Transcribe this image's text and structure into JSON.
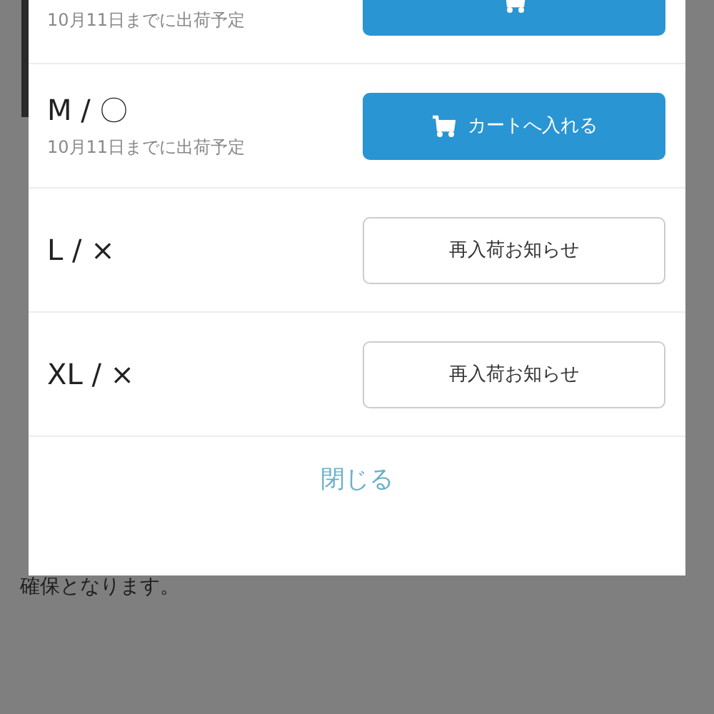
{
  "background": {
    "text": "確保となります。"
  },
  "dialog": {
    "rows": [
      {
        "kind": "cart",
        "note": "10月11日までに出荷予定"
      },
      {
        "kind": "cart",
        "size": "M / 〇",
        "note": "10月11日までに出荷予定",
        "button": "カートへ入れる"
      },
      {
        "kind": "notify",
        "size": "L / ×",
        "button": "再入荷お知らせ"
      },
      {
        "kind": "notify",
        "size": "XL / ×",
        "button": "再入荷お知らせ"
      }
    ],
    "close": "閉じる"
  }
}
